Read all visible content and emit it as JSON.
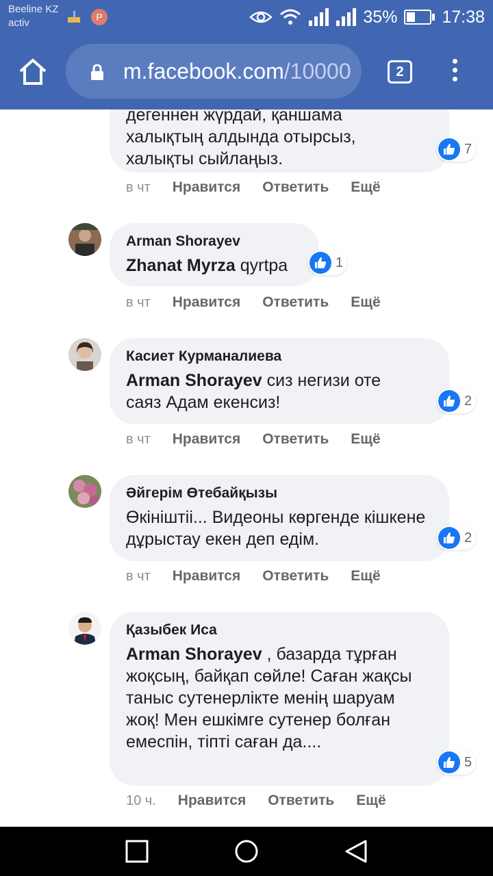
{
  "status_bar": {
    "carrier_line1": "Beeline KZ",
    "carrier_line2": "activ",
    "badge": "P",
    "battery": "35%",
    "time": "17:38"
  },
  "browser": {
    "url_domain": "m.facebook.com",
    "url_path": "/10000",
    "tab_count": "2"
  },
  "top_partial": {
    "line0": "дегеннен жүрдай, қаншама",
    "line1": "халықтың алдында отырсыз,",
    "line2": "халықты сыйлаңыз.",
    "likes": "7",
    "time": "в чт"
  },
  "comments": [
    {
      "author": "Arman Shorayev",
      "mention": "Zhanat Myrza",
      "text": " qyrtpa",
      "likes": "1",
      "time": "в чт"
    },
    {
      "author": "Касиет Курманалиева",
      "mention": "Arman Shorayev",
      "text": " сиз негизи оте саяз Адам екенсиз!",
      "likes": "2",
      "time": "в чт"
    },
    {
      "author": "Әйгерім Өтебайқызы",
      "mention": "",
      "text": "Өкініштіі... Видеоны көргенде кішкене дұрыстау екен деп едім.",
      "likes": "2",
      "time": "в чт"
    },
    {
      "author": "Қазыбек Иса",
      "mention": "Arman Shorayev",
      "text": " , базарда тұрған жоқсың, байқап сөйле! Саған жақсы таныс сутенерлікте менің шаруам жоқ! Мен ешкімге сутенер болған емеспін, тіпті саған да....",
      "likes": "5",
      "time": "10 ч."
    }
  ],
  "actions": {
    "like": "Нравится",
    "reply": "Ответить",
    "more": "Ещё"
  },
  "colors": {
    "facebook_blue": "#4267b2",
    "like_blue": "#1877f2",
    "bubble_grey": "#f0f2f5"
  }
}
